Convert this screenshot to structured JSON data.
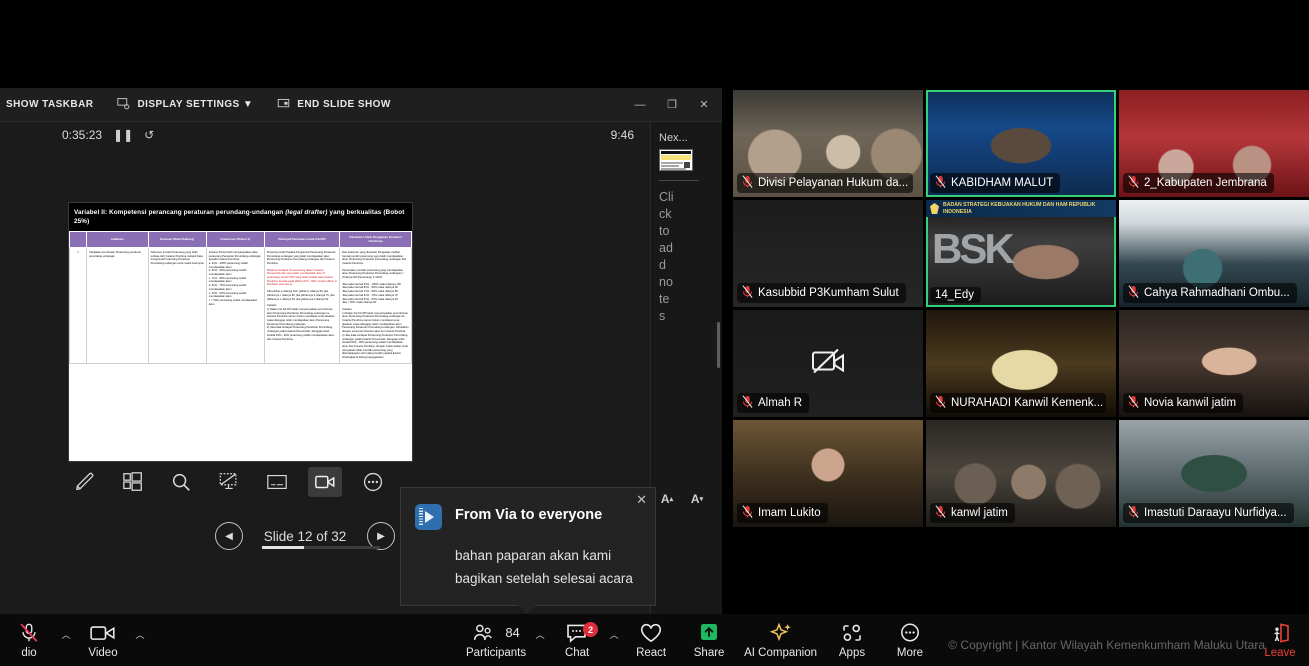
{
  "ppt": {
    "toolbar": {
      "show_taskbar": "SHOW TASKBAR",
      "display_settings": "DISPLAY SETTINGS ▼",
      "end_slide_show": "END SLIDE SHOW"
    },
    "window_controls": {
      "minimize": "—",
      "restore": "❐",
      "close": "✕"
    },
    "timer": "0:35:23",
    "clock": "9:46",
    "slide": {
      "title_a": "Variabel II: Kompetensi perancang peraturan perundang-undangan ",
      "title_em": "(legal drafter)",
      "title_b": " yang berkualitas (Bobot 25%)",
      "headers": [
        "Indikator",
        "Kelusan (Data Dukung)",
        "Kuesioner (Bobot 1)",
        "Petunjuk Panduan untuk K/L/PD",
        "Panduan Untuk Pengawas (Instansi Pembina)"
      ],
      "rows": [
        {
          "no": "1",
          "c1": "Kebijakan pembinaan Perancang peraturan perundang-undangan",
          "c2": "Dokumen jumlah Perancang yang telah terdata oleh Instansi Pembina meliputi Data Fungsional Perancang Peraturan Perundang-undangan serta matrik kelompok",
          "c3": "Instansi Pemerintah menyampaikan data perancang Peraturan Perundang-undangan kepada Instansi Pembina:\na. 91% - 100% perancang sudah mendapatkan akun\nb. 81% - 90% perancang sudah mendapatkan akun\nc. 71% - 80% perancang sudah mendapatkan akun\nd. 61% - 70% perancang sudah mendapatkan akun\ne. 51% - 60% perancang sudah mendapatkan akun\nf. < 50% perancang sudah mendapatkan akun",
          "c4_p1": "Proporsi jumlah Pejabat Fungsional Perancang Peraturan Perundang-undangan yang telah mendapatkan akun Perancang Peraturan Perundang-undangan dari Instansi Pembina.",
          "c4_red": "Misalnya terdapat 10 perancang dalam Instansi Pemerintah dan yang telah mendapatkan akun 5 perancang, berarti 50% yang telah terdata oleh Instansi Pembina, berada pada pilihan 61% - 60%, berarti pilihan d. Demikian seterusnya.",
          "c4_p3": "Jika pilihan a nilainya 100, pilihan b nilainya 90, jika pilihannya c nilainya 80, jika pilihannya d nilainya 70, jika pilihannya e nilainya 60, jika pilihannya f nilainya 50",
          "c4_note": "Catatan:\n1) Dalam hal K/L/PD telah menyampaikan permohonan akun Perancang Peraturan Perundang-undangan ke Instansi Pembina namun belum mendapat surat jawaban maka dianggap telah mendapatkan akun Perancang Peraturan Perundang-undangan.\n2) Jika tidak terdapat Perancang Peraturan Perundang-undangan pada Instansi Pemerintah, dianggap telah berada 81% - 90% perancang sudah mendapatkan akun dari Instansi Pembina.",
          "c5_p1": "Dari dokumen yang diupload, Pengawas melihat banyak jumlah perancang yang telah mendapatkan akun Perancang Peraturan Perundang-undangan dari Instansi Pembina.",
          "c5_p2": "Persentase (Jumlah perancang yang mendapatkan akun Perancang Peraturan Perundang-undangan) / (Total jumlah Perancang) X 100%",
          "c5_list": "Jika pada interval 91% - 100% maka nilainya 100\nJika pada interval 81% - 90% maka nilainya 90\nJika pada interval 71% - 80% maka nilainya 80\nJika pada interval 61% - 70% maka nilainya 70\nJika pada interval 51% - 60% maka nilainya 60\nJika < 50% maka nilainya 50",
          "c5_note": "Catatan:\n1) Dalam hal K/L/PD telah menyampaikan permohonan akun Perancang Peraturan Perundang-undangan ke Instansi Pembina namun belum mendapat surat jawaban maka dianggap telah mendapatkan akun Perancang Peraturan Perundang-undangan. Dibuktikan dengan surat permohonan akun ke Instansi Pembina.\n2) Jika tidak terdapat Perancang Peraturan Perundang-undangan pada Instansi Pemerintah, dianggap telah berada 81% - 90% perancang sudah mendapatkan akun dari Instansi Pembina, dengan melampirkan surat pernyataan tidak memiliki perancang yang ditandatangani oleh paling rendah pejabat Eselon II/setingkat di bidang kepegawaian."
        }
      ]
    },
    "tools": [
      {
        "name": "pen-tool",
        "label": "Pen"
      },
      {
        "name": "all-slides-tool",
        "label": "All Slides"
      },
      {
        "name": "zoom-tool",
        "label": "Zoom"
      },
      {
        "name": "black-screen-tool",
        "label": "Black Screen"
      },
      {
        "name": "subtitle-tool",
        "label": "Subtitles"
      },
      {
        "name": "camera-tool",
        "label": "Camera"
      },
      {
        "name": "more-tool",
        "label": "More"
      }
    ],
    "nav": {
      "prev": "◀",
      "next": "▶",
      "slide_label": "Slide 12 of 32"
    },
    "notes": {
      "next_label": "Nex...",
      "placeholder": "Click to add notes"
    }
  },
  "toast": {
    "from": "From Via to everyone",
    "message": "bahan paparan akan kami bagikan setelah selesai acara",
    "close": "✕",
    "font_increase": "A",
    "font_decrease": "A"
  },
  "gallery": {
    "tiles": [
      {
        "name": "Divisi Pelayanan Hukum da...",
        "muted": true,
        "speaking": false,
        "camera_off": false,
        "bg": "bg1"
      },
      {
        "name": "KABIDHAM MALUT",
        "muted": true,
        "speaking": true,
        "camera_off": false,
        "bg": "bg2"
      },
      {
        "name": "2_Kabupaten Jembrana",
        "muted": true,
        "speaking": false,
        "camera_off": false,
        "bg": "bg3"
      },
      {
        "name": "Kasubbid P3Kumham Sulut",
        "muted": true,
        "speaking": false,
        "camera_off": false,
        "bg": "bg4"
      },
      {
        "name": "14_Edy",
        "muted": false,
        "speaking": true,
        "camera_off": false,
        "bg": "bg5",
        "banner": "BADAN STRATEGI KEBIJAKAN HUKUM DAN HAM REPUBLIK INDONESIA",
        "watermark": "BSK"
      },
      {
        "name": "Cahya Rahmadhani Ombu...",
        "muted": true,
        "speaking": false,
        "camera_off": false,
        "bg": "bg6"
      },
      {
        "name": "Almah R",
        "muted": true,
        "speaking": false,
        "camera_off": true,
        "bg": "bg7"
      },
      {
        "name": "NURAHADI Kanwil Kemenk...",
        "muted": true,
        "speaking": false,
        "camera_off": false,
        "bg": "bg8"
      },
      {
        "name": "Novia kanwil jatim",
        "muted": true,
        "speaking": false,
        "camera_off": false,
        "bg": "bg9"
      },
      {
        "name": "Imam Lukito",
        "muted": true,
        "speaking": false,
        "camera_off": false,
        "bg": "bg10"
      },
      {
        "name": "kanwl jatim",
        "muted": true,
        "speaking": false,
        "camera_off": false,
        "bg": "bg11"
      },
      {
        "name": "Imastuti Daraayu Nurfidya...",
        "muted": true,
        "speaking": false,
        "camera_off": false,
        "bg": "bg12"
      }
    ]
  },
  "bottombar": {
    "audio": {
      "label": "dio",
      "caret": "︿"
    },
    "video": {
      "label": "Video",
      "caret": "︿"
    },
    "participants": {
      "label": "Participants",
      "count": "84",
      "caret": "︿"
    },
    "chat": {
      "label": "Chat",
      "badge": "2",
      "caret": "︿"
    },
    "react": {
      "label": "React"
    },
    "share": {
      "label": "Share"
    },
    "ai_companion": {
      "label": "AI Companion"
    },
    "apps": {
      "label": "Apps"
    },
    "more": {
      "label": "More"
    },
    "leave": {
      "label": "Leave"
    },
    "copyright": "© Copyright | Kantor Wilayah Kemenkumham Maluku Utara"
  }
}
